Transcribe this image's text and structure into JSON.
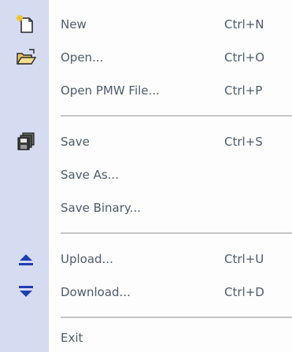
{
  "menu": {
    "items": [
      {
        "label": "New",
        "shortcut": "Ctrl+N",
        "icon": "new-file-icon"
      },
      {
        "label": "Open...",
        "shortcut": "Ctrl+O",
        "icon": "open-folder-icon"
      },
      {
        "label": "Open PMW File...",
        "shortcut": "Ctrl+P",
        "icon": ""
      },
      {
        "label": "Save",
        "shortcut": "Ctrl+S",
        "icon": "save-disks-icon"
      },
      {
        "label": "Save As...",
        "shortcut": "",
        "icon": ""
      },
      {
        "label": "Save Binary...",
        "shortcut": "",
        "icon": ""
      },
      {
        "label": "Upload...",
        "shortcut": "Ctrl+U",
        "icon": "upload-icon"
      },
      {
        "label": "Download...",
        "shortcut": "Ctrl+D",
        "icon": "download-icon"
      },
      {
        "label": "Exit",
        "shortcut": "",
        "icon": ""
      }
    ]
  },
  "colors": {
    "gutter": "#d5dcf2",
    "text": "#4d5b6b",
    "separator": "#c5c5c5",
    "icon_blue": "#1f3fb0"
  }
}
